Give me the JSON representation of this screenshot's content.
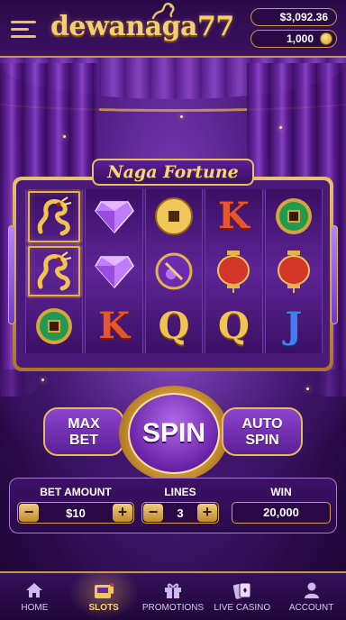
{
  "header": {
    "logo_text": "dewanaga77",
    "balance_money": "$3,092.36",
    "balance_coins": "1,000"
  },
  "game": {
    "title": "Naga Fortune",
    "reels": [
      [
        "dragon",
        "dragon",
        "jade-coin"
      ],
      [
        "purple-gem",
        "purple-gem",
        "K"
      ],
      [
        "gold-coin",
        "bonus-orb",
        "Q"
      ],
      [
        "K",
        "red-lantern",
        "Q"
      ],
      [
        "jade-coin",
        "red-lantern",
        "J"
      ]
    ]
  },
  "controls": {
    "max_bet_line1": "MAX",
    "max_bet_line2": "BET",
    "spin_label": "SPIN",
    "auto_spin_line1": "AUTO",
    "auto_spin_line2": "SPIN",
    "bet_amount_label": "BET AMOUNT",
    "bet_amount_value": "$10",
    "lines_label": "LINES",
    "lines_value": "3",
    "win_label": "WIN",
    "win_value": "20,000",
    "minus": "−",
    "plus": "+"
  },
  "nav": {
    "items": [
      {
        "label": "HOME",
        "icon": "home-icon"
      },
      {
        "label": "SLOTS",
        "icon": "slot-machine-icon"
      },
      {
        "label": "PROMOTIONS",
        "icon": "gift-icon"
      },
      {
        "label": "LIVE CASINO",
        "icon": "cards-icon"
      },
      {
        "label": "ACCOUNT",
        "icon": "person-icon"
      }
    ],
    "active": "SLOTS"
  },
  "colors": {
    "gold": "#e3ba5c",
    "purple_dark": "#2a0a45",
    "purple_mid": "#5a1f95",
    "accent_red": "#d2372a"
  }
}
